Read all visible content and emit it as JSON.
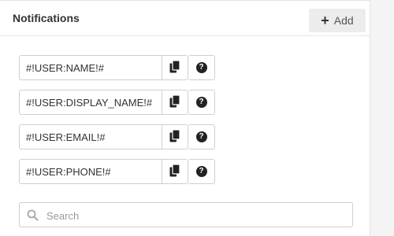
{
  "header": {
    "title": "Notifications",
    "add_icon": "plus-icon",
    "add_label": "Add"
  },
  "tags": [
    {
      "value": "#!USER:NAME!#",
      "copy_icon": "copy-icon",
      "help_icon": "question-circle-icon"
    },
    {
      "value": "#!USER:DISPLAY_NAME!#",
      "copy_icon": "copy-icon",
      "help_icon": "question-circle-icon"
    },
    {
      "value": "#!USER:EMAIL!#",
      "copy_icon": "copy-icon",
      "help_icon": "question-circle-icon"
    },
    {
      "value": "#!USER:PHONE!#",
      "copy_icon": "copy-icon",
      "help_icon": "question-circle-icon"
    }
  ],
  "search": {
    "icon": "search-icon",
    "placeholder": "Search",
    "value": ""
  },
  "colors": {
    "panel_bg": "#ffffff",
    "page_bg": "#f4f4f4",
    "button_bg": "#ececec",
    "border": "#cfcfcf"
  }
}
